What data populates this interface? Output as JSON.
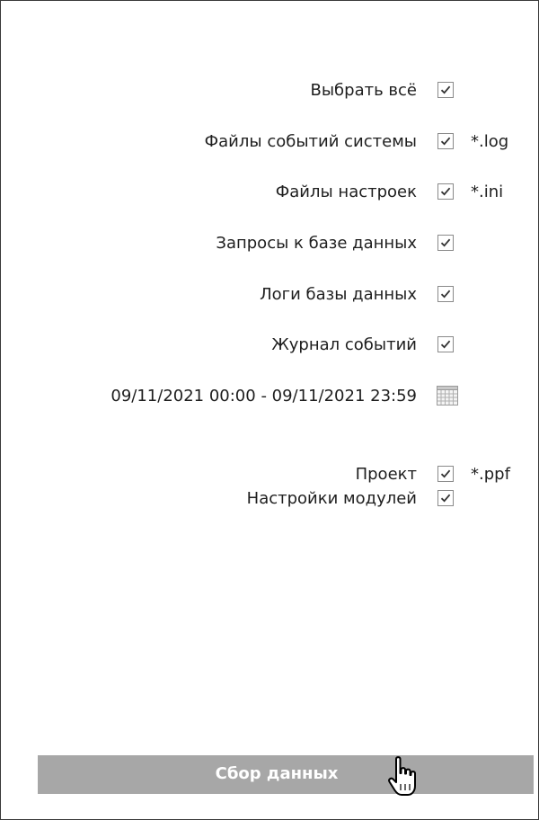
{
  "options": [
    {
      "label": "Выбрать всё",
      "checked": true,
      "ext": ""
    },
    {
      "label": "Файлы событий системы",
      "checked": true,
      "ext": "*.log"
    },
    {
      "label": "Файлы настроек",
      "checked": true,
      "ext": "*.ini"
    },
    {
      "label": "Запросы к базе данных",
      "checked": true,
      "ext": ""
    },
    {
      "label": "Логи базы данных",
      "checked": true,
      "ext": ""
    },
    {
      "label": "Журнал событий",
      "checked": true,
      "ext": ""
    },
    {
      "label": "Проект",
      "checked": true,
      "ext": "*.ppf"
    },
    {
      "label": "Настройки модулей",
      "checked": true,
      "ext": ""
    }
  ],
  "date_range": {
    "text": "09/11/2021 00:00 - 09/11/2021 23:59",
    "icon": "calendar-icon"
  },
  "collect_button": {
    "label": "Сбор данных"
  },
  "cursor": {
    "icon": "hand-pointer-cursor-icon"
  },
  "colors": {
    "button_bg": "#a7a7a7",
    "button_text": "#ffffff",
    "check_mark": "#333333",
    "checkbox_border": "#8a8a8a"
  }
}
